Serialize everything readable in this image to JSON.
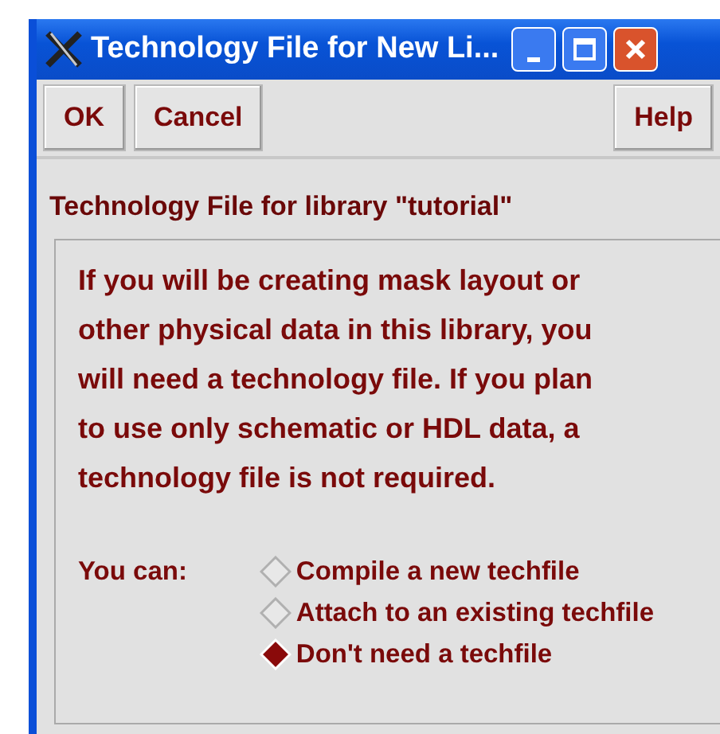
{
  "window": {
    "title": "Technology File for New Li..."
  },
  "buttons": [
    {
      "label": "OK",
      "kind": "left"
    },
    {
      "label": "Cancel",
      "kind": "left"
    },
    {
      "label": "Help",
      "kind": "right"
    }
  ],
  "section_label": "Technology File for library \"tutorial\"",
  "paragraph_lines": [
    "If you will be creating mask layout or",
    "other physical data in this library, you",
    "will need a technology file. If you plan",
    "to use only schematic or HDL data, a",
    "technology file is not required."
  ],
  "options_label": "You can:",
  "options": [
    {
      "label": "Compile a new techfile",
      "selected": false
    },
    {
      "label": "Attach to an existing techfile",
      "selected": false
    },
    {
      "label": "Don't need a techfile",
      "selected": true
    }
  ]
}
